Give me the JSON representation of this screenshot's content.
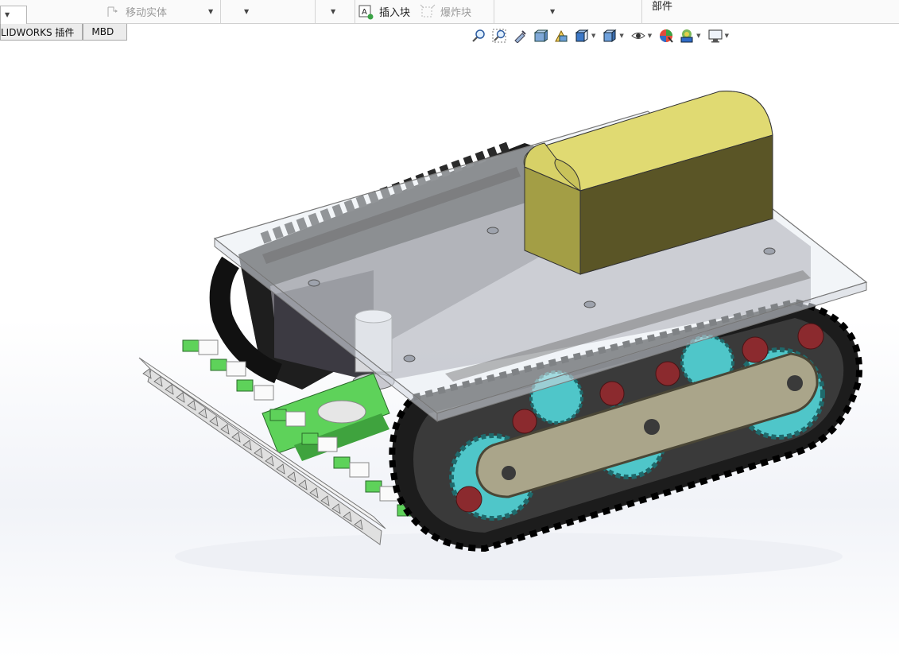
{
  "ribbon": {
    "move_body_label": "移动实体",
    "insert_block_label": "插入块",
    "explode_block_label": "爆炸块",
    "part_label": "部件"
  },
  "tabs": [
    {
      "label": "LIDWORKS 插件"
    },
    {
      "label": "MBD"
    }
  ],
  "view_toolbar": {
    "icons": [
      "zoom-to-fit-icon",
      "zoom-area-icon",
      "previous-view-icon",
      "section-view-icon",
      "dynamic-annotation-icon",
      "view-orientation-icon",
      "display-style-icon",
      "hide-show-items-icon",
      "edit-appearance-icon",
      "apply-scene-icon",
      "view-settings-icon"
    ]
  },
  "colors": {
    "battery_box": "#c9c35a",
    "sprocket": "#4fc6c9",
    "bolt": "#8b2a2e",
    "bracket": "#aaa58a",
    "green_block": "#5ed25a",
    "track": "#1c1c1c"
  }
}
